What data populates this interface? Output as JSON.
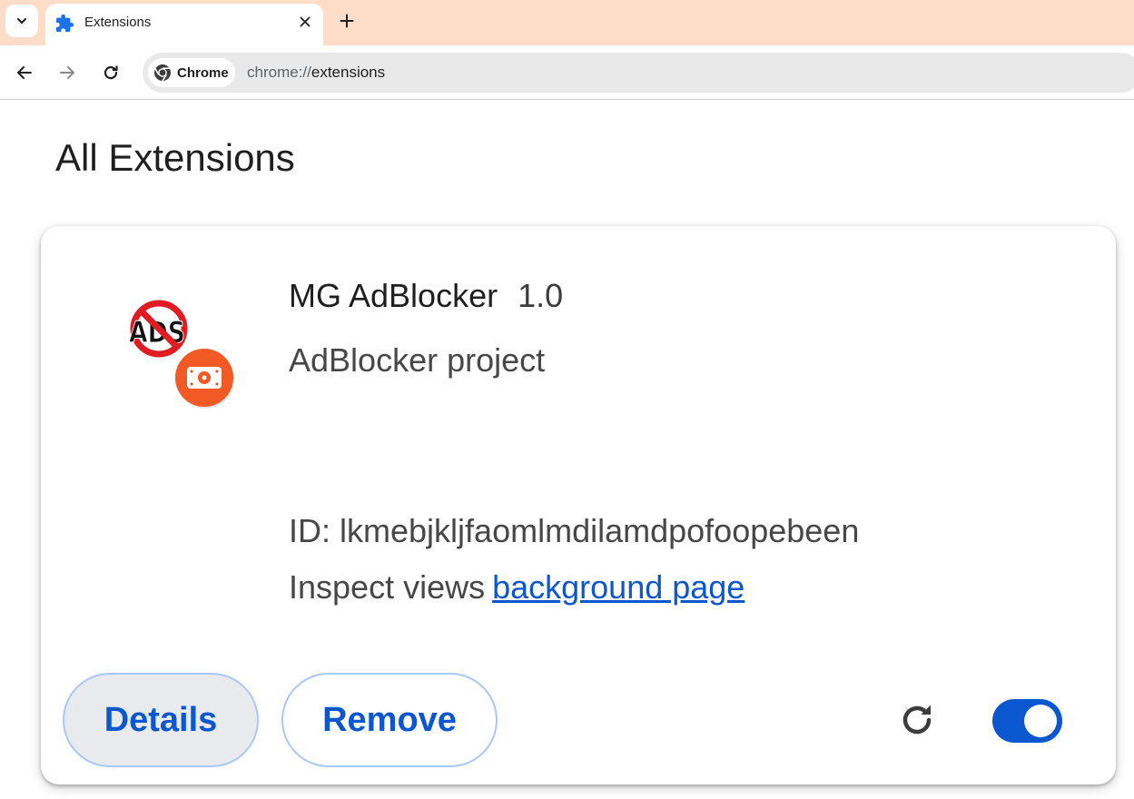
{
  "browser": {
    "tab": {
      "title": "Extensions",
      "close_symbol": "✕"
    },
    "new_tab_symbol": "+",
    "omnibox": {
      "chip_label": "Chrome",
      "url_scheme": "chrome://",
      "url_path": "extensions"
    }
  },
  "page": {
    "title": "All Extensions"
  },
  "extension": {
    "name": "MG AdBlocker",
    "version": "1.0",
    "description": "AdBlocker project",
    "icon_text": "ADS",
    "id_label": "ID:",
    "id": "lkmebjkljfaomlmdilamdpofoopebeen",
    "inspect_label": "Inspect views",
    "inspect_link": "background page",
    "details_label": "Details",
    "remove_label": "Remove",
    "enabled": true
  },
  "colors": {
    "tabstrip": "#fddcc8",
    "accent": "#0b57d0",
    "button_border": "#a8c7fa",
    "icon_red": "#e11b22",
    "icon_orange": "#f15a24"
  }
}
